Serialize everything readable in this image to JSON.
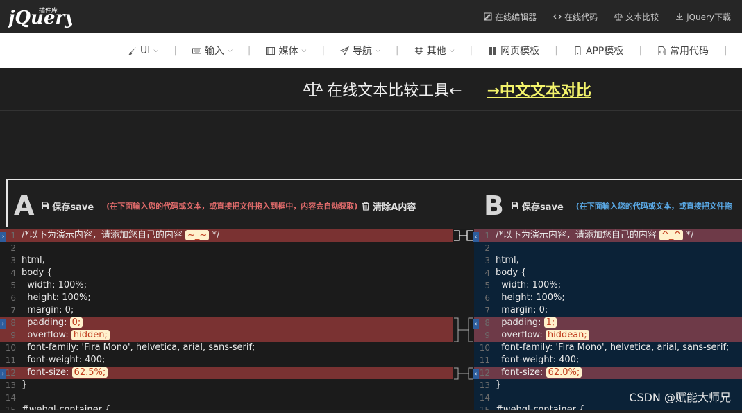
{
  "topbar": {
    "logo_text": "jQuery",
    "logo_sub": "插件库",
    "links": [
      {
        "label": "在线编辑器",
        "icon": "edit-icon"
      },
      {
        "label": "在线代码",
        "icon": "code-icon"
      },
      {
        "label": "文本比较",
        "icon": "scale-icon"
      },
      {
        "label": "jQuery下载",
        "icon": "download-icon"
      }
    ]
  },
  "nav": {
    "items": [
      {
        "label": "UI",
        "icon": "brush-icon",
        "dropdown": true
      },
      {
        "label": "输入",
        "icon": "keyboard-icon",
        "dropdown": true
      },
      {
        "label": "媒体",
        "icon": "film-icon",
        "dropdown": true
      },
      {
        "label": "导航",
        "icon": "send-icon",
        "dropdown": true
      },
      {
        "label": "其他",
        "icon": "dropbox-icon",
        "dropdown": true
      },
      {
        "label": "网页模板",
        "icon": "grid-icon",
        "dropdown": false
      },
      {
        "label": "APP模板",
        "icon": "mobile-icon",
        "dropdown": false
      },
      {
        "label": "常用代码",
        "icon": "file-code-icon",
        "dropdown": false
      }
    ]
  },
  "banner": {
    "title": "在线文本比较工具←",
    "link": "→中文文本对比"
  },
  "paneA": {
    "letter": "A",
    "save": "保存save",
    "hint": "(在下面输入您的代码或文本，或直接把文件拖入到框中，内容会自动获取)",
    "clear": "清除A内容",
    "hint_color": "#e06b6b"
  },
  "paneB": {
    "letter": "B",
    "save": "保存save",
    "hint": "(在下面输入您的代码或文本，或直接把文件拖",
    "hint_color": "#5aa9e6"
  },
  "editorA": {
    "lines": [
      {
        "n": "1",
        "text": "/*以下为演示内容，请添加您自己的内容 ",
        "chip": "~_~",
        "after": " */",
        "hl": true
      },
      {
        "n": "2",
        "text": "",
        "hl": false
      },
      {
        "n": "3",
        "text": "html,",
        "hl": false
      },
      {
        "n": "4",
        "text": "body {",
        "hl": false
      },
      {
        "n": "5",
        "text": "  width: 100%;",
        "hl": false
      },
      {
        "n": "6",
        "text": "  height: 100%;",
        "hl": false
      },
      {
        "n": "7",
        "text": "  margin: 0;",
        "hl": false
      },
      {
        "n": "8",
        "text": "  padding: ",
        "chip": "0;",
        "after": "",
        "hl": true
      },
      {
        "n": "9",
        "text": "  overflow: ",
        "chip": "hidden;",
        "after": "",
        "hl": true
      },
      {
        "n": "10",
        "text": "  font-family: 'Fira Mono', helvetica, arial, sans-serif;",
        "hl": false
      },
      {
        "n": "11",
        "text": "  font-weight: 400;",
        "hl": false
      },
      {
        "n": "12",
        "text": "  font-size: ",
        "chip": "62.5%;",
        "after": "",
        "hl": true
      },
      {
        "n": "13",
        "text": "}",
        "hl": false
      },
      {
        "n": "14",
        "text": "",
        "hl": false
      },
      {
        "n": "15",
        "text": "#webgl-container {",
        "hl": false
      }
    ]
  },
  "editorB": {
    "lines": [
      {
        "n": "1",
        "text": "/*以下为演示内容，请添加您自己的内容 ",
        "chip": "^_^",
        "after": " */",
        "hl": true
      },
      {
        "n": "2",
        "text": "",
        "hl": false
      },
      {
        "n": "3",
        "text": "html,",
        "hl": false
      },
      {
        "n": "4",
        "text": "body {",
        "hl": false
      },
      {
        "n": "5",
        "text": "  width: 100%;",
        "hl": false
      },
      {
        "n": "6",
        "text": "  height: 100%;",
        "hl": false
      },
      {
        "n": "7",
        "text": "  margin: 0;",
        "hl": false
      },
      {
        "n": "8",
        "text": "  padding: ",
        "chip": "1;",
        "after": "",
        "hl": true
      },
      {
        "n": "9",
        "text": "  overflow: ",
        "chip": "hiddean;",
        "after": "",
        "hl": true
      },
      {
        "n": "10",
        "text": "  font-family: 'Fira Mono', helvetica, arial, sans-serif;",
        "hl": false
      },
      {
        "n": "11",
        "text": "  font-weight: 400;",
        "hl": false
      },
      {
        "n": "12",
        "text": "  font-size: ",
        "chip": "62.0%;",
        "after": "",
        "hl": true
      },
      {
        "n": "13",
        "text": "}",
        "hl": false
      },
      {
        "n": "14",
        "text": "",
        "hl": false
      },
      {
        "n": "15",
        "text": "#webgl-container {",
        "hl": false
      }
    ]
  },
  "watermark": "CSDN @赋能大师兄",
  "colors": {
    "diff_bg_a": "#7a3232",
    "diff_bg_b": "#6e3a48",
    "editor_b_bg": "#0b2237",
    "banner_link": "#f3f36b"
  }
}
